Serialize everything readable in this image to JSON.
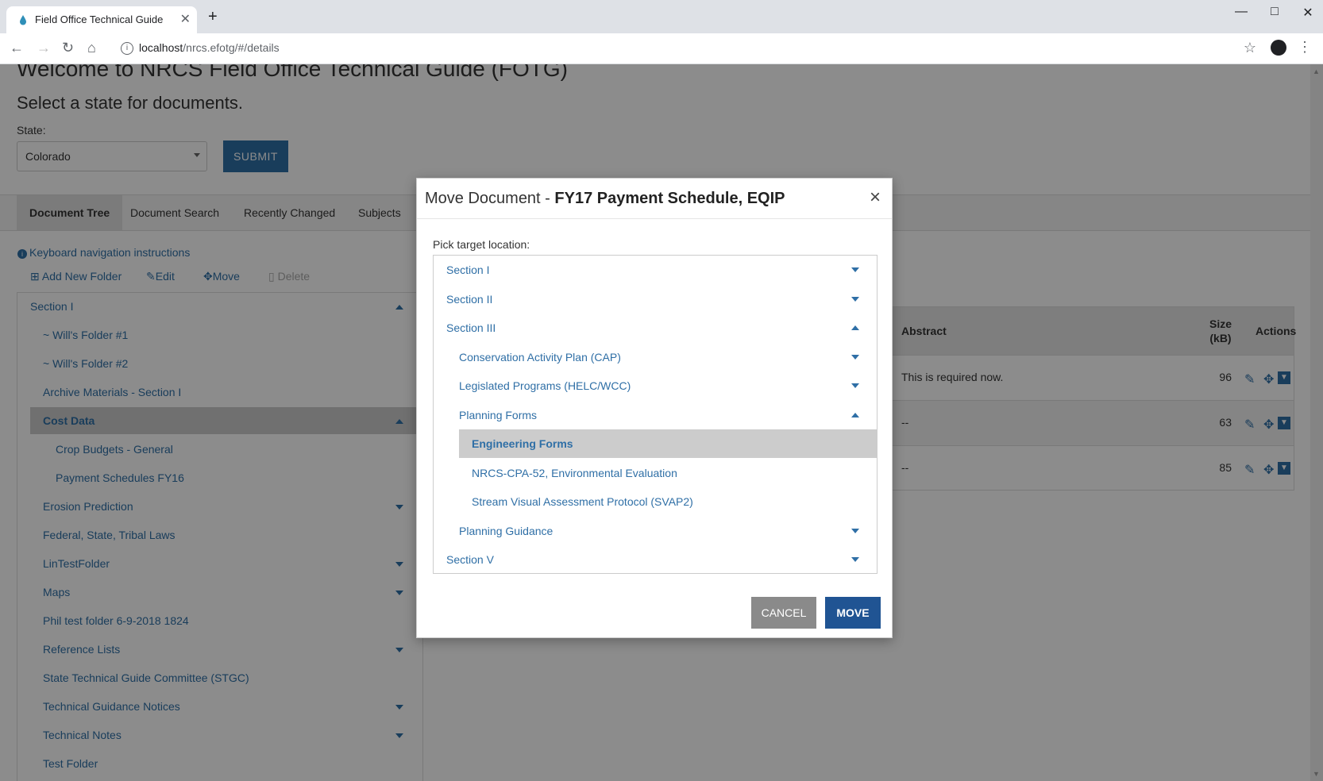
{
  "browser": {
    "tab_title": "Field Office Technical Guide",
    "url_host": "localhost",
    "url_path": "/nrcs.efotg/#/details",
    "new_tab_symbol": "+",
    "close_symbol": "✕"
  },
  "header": {
    "welcome": "Welcome to NRCS Field Office Technical Guide (FOTG)",
    "subtitle": "Select a state for documents.",
    "state_label": "State:",
    "state_value": "Colorado",
    "submit_label": "SUBMIT"
  },
  "tabs": [
    "Document Tree",
    "Document Search",
    "Recently Changed",
    "Subjects"
  ],
  "tree_toolbar": {
    "kbd_nav": "Keyboard navigation instructions",
    "add_folder": "Add New Folder",
    "edit": "Edit",
    "move": "Move",
    "delete": "Delete"
  },
  "tree": [
    {
      "label": "Section I",
      "level": 0,
      "caret": "up"
    },
    {
      "label": "~ Will's Folder #1",
      "level": 1
    },
    {
      "label": "~ Will's Folder #2",
      "level": 1
    },
    {
      "label": "Archive Materials - Section I",
      "level": 1
    },
    {
      "label": "Cost Data",
      "level": 1,
      "caret": "up",
      "selected": true
    },
    {
      "label": "Crop Budgets - General",
      "level": 2
    },
    {
      "label": "Payment Schedules FY16",
      "level": 2
    },
    {
      "label": "Erosion Prediction",
      "level": 1,
      "caret": "down"
    },
    {
      "label": "Federal, State, Tribal Laws",
      "level": 1
    },
    {
      "label": "LinTestFolder",
      "level": 1,
      "caret": "down"
    },
    {
      "label": "Maps",
      "level": 1,
      "caret": "down"
    },
    {
      "label": "Phil test folder 6-9-2018 1824",
      "level": 1
    },
    {
      "label": "Reference Lists",
      "level": 1,
      "caret": "down"
    },
    {
      "label": "State Technical Guide Committee (STGC)",
      "level": 1
    },
    {
      "label": "Technical Guidance Notices",
      "level": 1,
      "caret": "down"
    },
    {
      "label": "Technical Notes",
      "level": 1,
      "caret": "down"
    },
    {
      "label": "Test Folder",
      "level": 1
    }
  ],
  "doc_table": {
    "headers": {
      "abstract": "Abstract",
      "size": "Size (kB)",
      "actions": "Actions"
    },
    "rows": [
      {
        "abstract": "This is required now.",
        "size": "96"
      },
      {
        "abstract": "--",
        "size": "63"
      },
      {
        "abstract": "--",
        "size": "85"
      }
    ]
  },
  "modal": {
    "title_prefix": "Move Document - ",
    "title_doc": "FY17 Payment Schedule, EQIP",
    "close": "×",
    "pick_label": "Pick target location:",
    "items": [
      {
        "label": "Section I",
        "level": 0,
        "caret": "down"
      },
      {
        "label": "Section II",
        "level": 0,
        "caret": "down"
      },
      {
        "label": "Section III",
        "level": 0,
        "caret": "up"
      },
      {
        "label": "Conservation Activity Plan (CAP)",
        "level": 1,
        "caret": "down"
      },
      {
        "label": "Legislated Programs (HELC/WCC)",
        "level": 1,
        "caret": "down"
      },
      {
        "label": "Planning Forms",
        "level": 1,
        "caret": "up"
      },
      {
        "label": "Engineering Forms",
        "level": 2,
        "selected": true
      },
      {
        "label": "NRCS-CPA-52, Environmental Evaluation",
        "level": 2
      },
      {
        "label": "Stream Visual Assessment Protocol (SVAP2)",
        "level": 2
      },
      {
        "label": "Planning Guidance",
        "level": 1,
        "caret": "down"
      },
      {
        "label": "Section V",
        "level": 0,
        "caret": "down"
      }
    ],
    "cancel_label": "CANCEL",
    "move_label": "MOVE"
  }
}
